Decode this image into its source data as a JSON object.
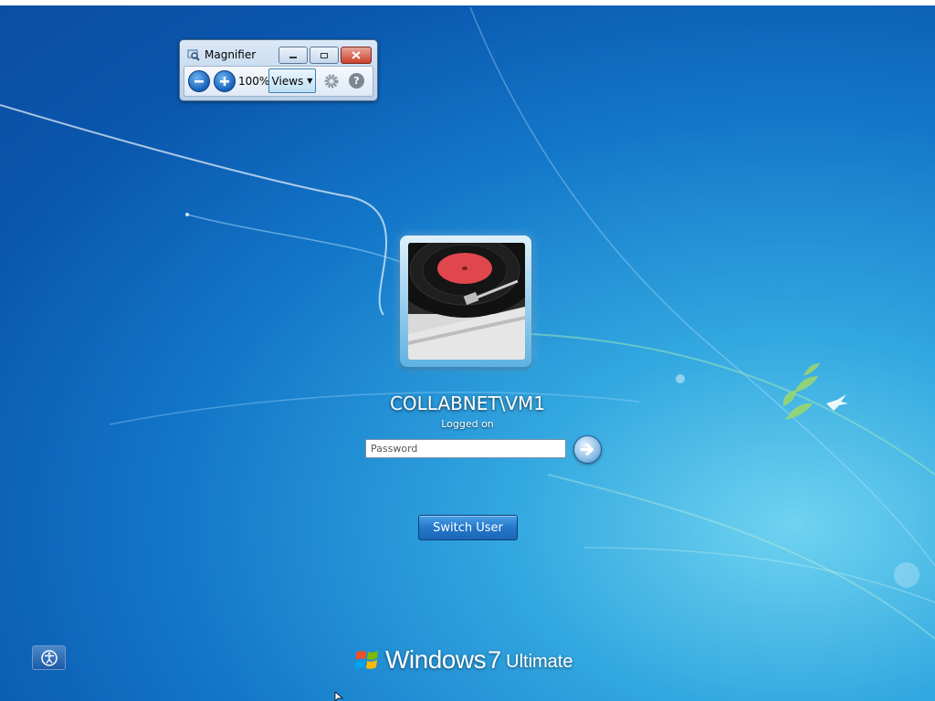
{
  "magnifier": {
    "title": "Magnifier",
    "zoom_level": "100%",
    "views_label": "Views",
    "caption_buttons": {
      "minimize": "minimize-icon",
      "restore": "restore-icon",
      "close": "close-icon"
    },
    "zoom_out_icon": "minus-icon",
    "zoom_in_icon": "plus-icon",
    "options_icon": "gear-icon",
    "help_label": "?"
  },
  "logon": {
    "username": "COLLABNET\\VM1",
    "status": "Logged on",
    "password_placeholder": "Password",
    "password_value": "",
    "submit_icon": "arrow-right-icon",
    "switch_user_label": "Switch User",
    "ease_of_access_icon": "ease-of-access-icon"
  },
  "branding": {
    "product": "Windows",
    "version": "7",
    "edition": "Ultimate"
  },
  "colors": {
    "background_dark": "#0a56ad",
    "background_light": "#6fd3f0",
    "close_button": "#c9402c",
    "button_blue": "#2377c9"
  }
}
